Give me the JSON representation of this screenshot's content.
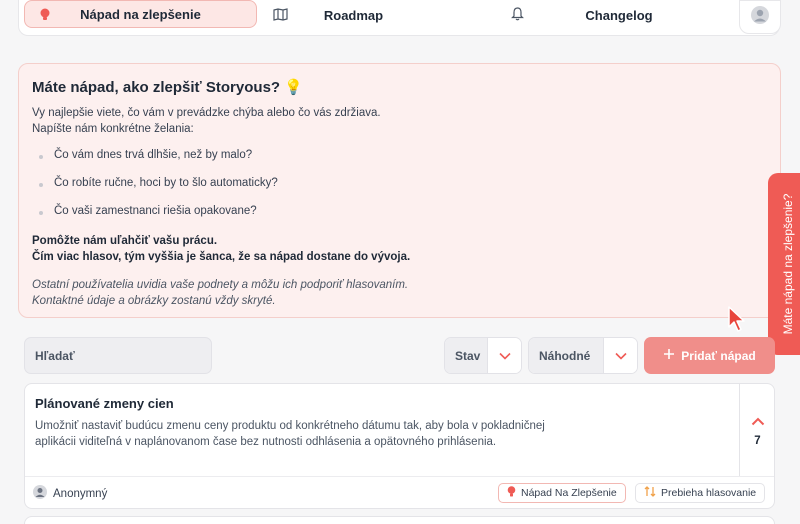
{
  "nav": {
    "tabs": [
      {
        "label": "Nápad na zlepšenie",
        "icon": "lightbulb-icon"
      },
      {
        "label": "Roadmap",
        "icon": "map-icon"
      },
      {
        "label": "Changelog",
        "icon": "bell-icon"
      }
    ]
  },
  "info": {
    "title": "Máte nápad, ako zlepšiť Storyous? 💡",
    "intro_1": "Vy najlepšie viete, čo vám v prevádzke chýba alebo čo vás zdržiava.",
    "intro_2": "Napíšte nám konkrétne želania:",
    "bullets": [
      "Čo vám dnes trvá dlhšie, než by malo?",
      "Čo robíte ručne, hoci by to šlo automaticky?",
      "Čo vaši zamestnanci riešia opakovane?"
    ],
    "strong_1": "Pomôžte nám uľahčiť vašu prácu.",
    "strong_2": "Čím viac hlasov, tým vyššia je šanca, že sa nápad dostane do vývoja.",
    "note_1": "Ostatní používatelia uvidia vaše podnety a môžu ich podporiť hlasovaním.",
    "note_2": "Kontaktné údaje a obrázky zostanú vždy skryté."
  },
  "side_tab": {
    "label": "Máte nápad na zlepšenie?"
  },
  "filters": {
    "search_placeholder": "Hľadať",
    "status_label": "Stav",
    "sort_label": "Náhodné",
    "add_button": "Pridať nápad"
  },
  "card": {
    "title": "Plánované zmeny cien",
    "description": "Umožniť nastaviť budúcu zmenu ceny produktu od konkrétneho dátumu tak, aby bola v pokladničnej aplikácii viditeľná v naplánovanom čase bez nutnosti odhlásenia a opätovného prihlásenia.",
    "votes": "7",
    "author": "Anonymný",
    "category_badge": "Nápad Na Zlepšenie",
    "status_badge": "Prebieha hlasovanie"
  },
  "colors": {
    "accent": "#ef5b55",
    "accent_light": "#fde7e5",
    "button": "#f08e8a"
  }
}
